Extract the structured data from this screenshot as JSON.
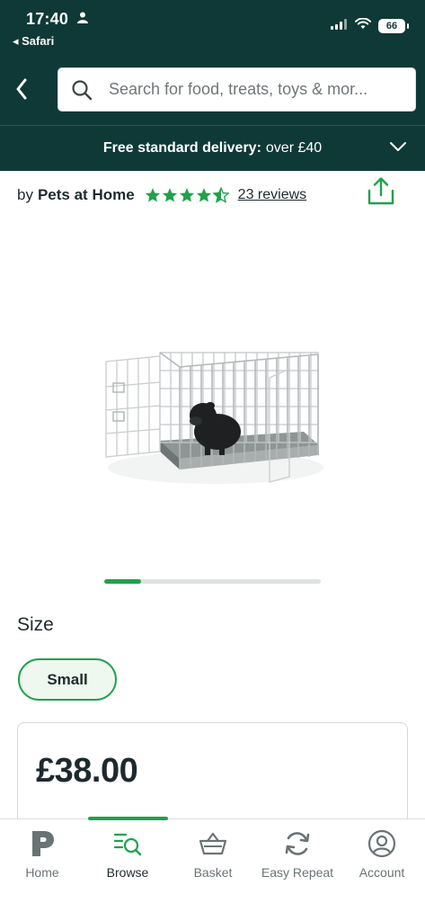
{
  "status_bar": {
    "time": "17:40",
    "back_app": "◂ Safari",
    "battery": "66"
  },
  "search": {
    "placeholder": "Search for food, treats, toys & mor..."
  },
  "delivery_banner": {
    "bold": "Free standard delivery:",
    "text": "over £40"
  },
  "product": {
    "by": "by",
    "brand": "Pets at Home",
    "rating": 4.5,
    "reviews": "23 reviews",
    "image_progress": 0.17,
    "size_label": "Size",
    "selected_size": "Small",
    "price": "£38.00"
  },
  "tabs": [
    {
      "label": "Home",
      "icon": "pets-at-home-logo-icon"
    },
    {
      "label": "Browse",
      "icon": "browse-search-icon"
    },
    {
      "label": "Basket",
      "icon": "basket-icon"
    },
    {
      "label": "Easy Repeat",
      "icon": "repeat-icon"
    },
    {
      "label": "Account",
      "icon": "account-icon"
    }
  ],
  "colors": {
    "header_bg": "#0f3936",
    "accent_green": "#1fa24a",
    "text_dark": "#1f2a2e"
  }
}
